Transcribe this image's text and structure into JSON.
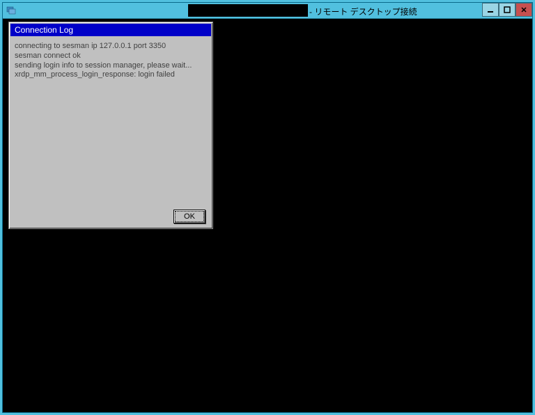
{
  "window": {
    "title_suffix": " - リモート デスクトップ接続"
  },
  "dialog": {
    "title": "Connection Log",
    "lines": [
      "connecting to sesman ip 127.0.0.1 port 3350",
      "sesman connect ok",
      "sending login info to session manager, please wait...",
      "xrdp_mm_process_login_response: login failed"
    ],
    "ok_label": "OK"
  }
}
